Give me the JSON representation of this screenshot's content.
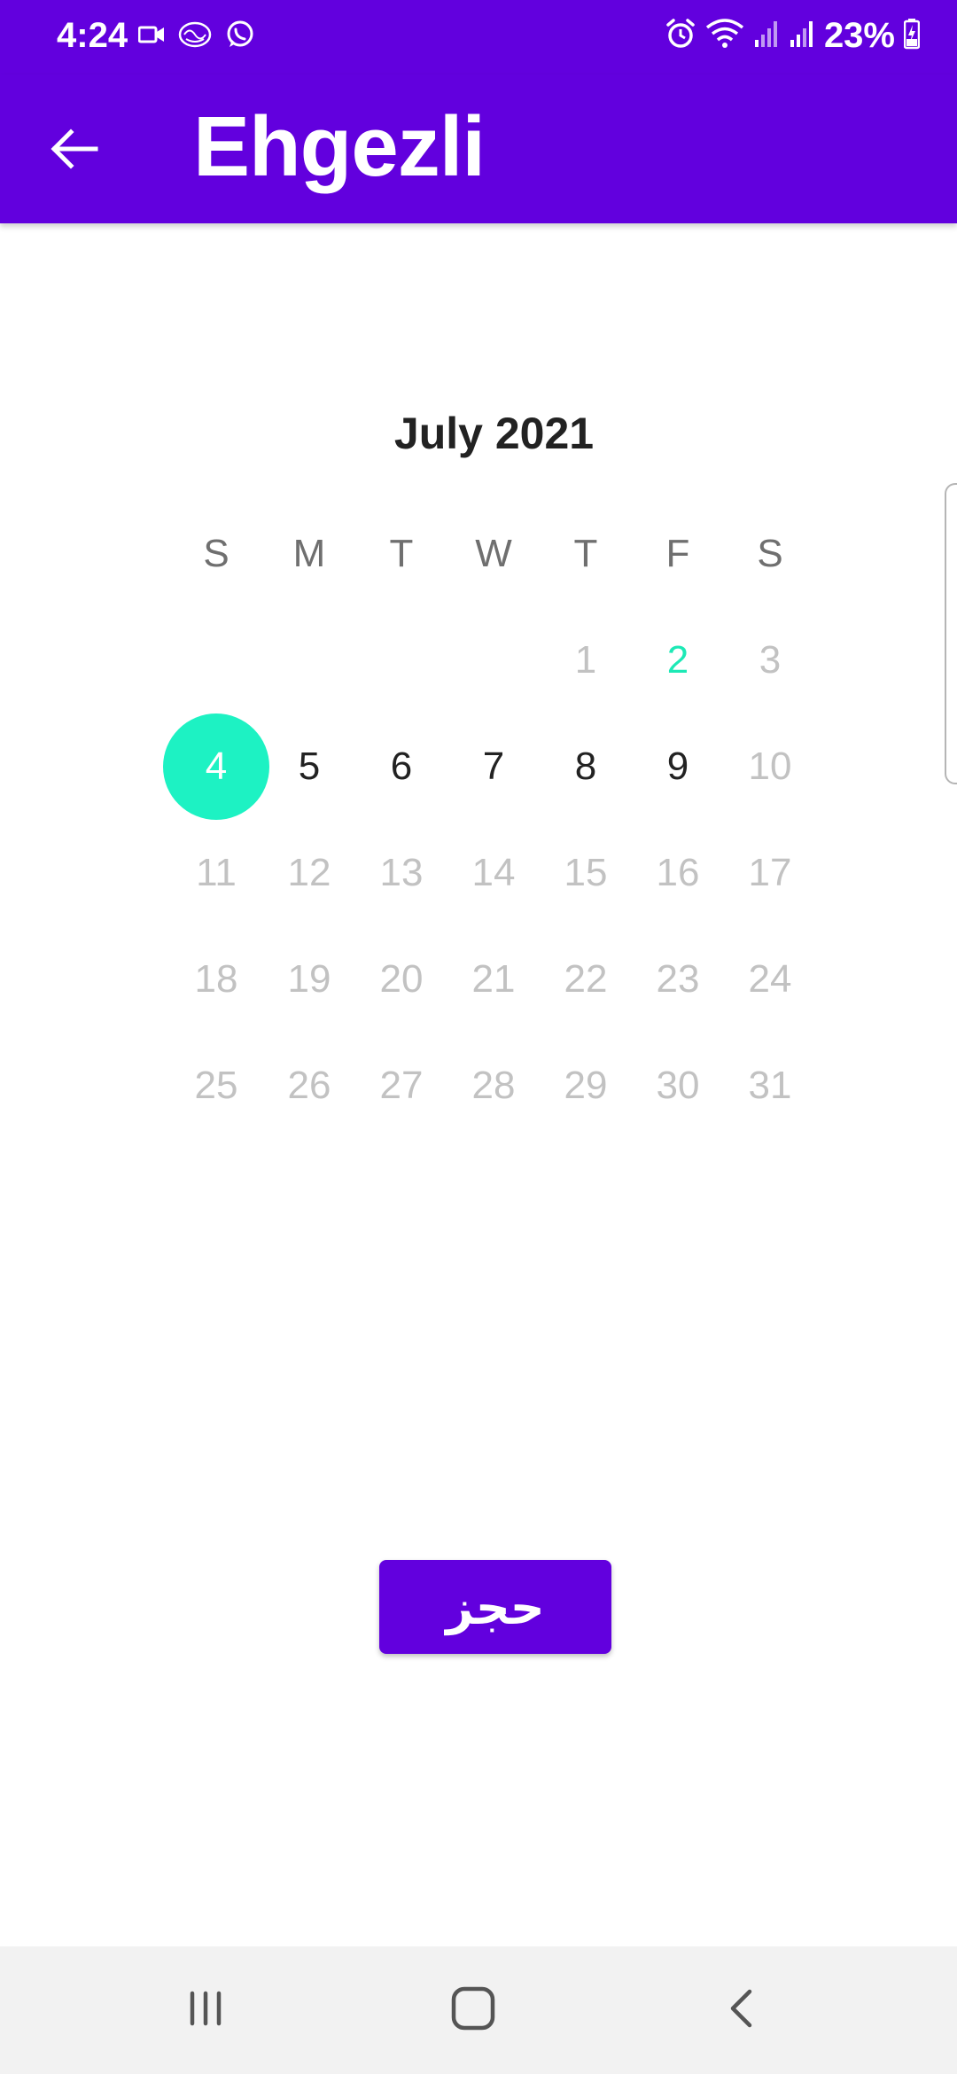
{
  "status_bar": {
    "time": "4:24",
    "battery": "23%",
    "icons_left": [
      "video-icon",
      "app-icon",
      "whatsapp-icon"
    ],
    "icons_right": [
      "alarm-icon",
      "wifi-icon",
      "signal-icon",
      "signal-icon",
      "battery-charging-icon"
    ]
  },
  "app_bar": {
    "title": "Ehgezli",
    "back_icon": "arrow-back-icon"
  },
  "calendar": {
    "month_label": "July 2021",
    "weekdays": [
      "S",
      "M",
      "T",
      "W",
      "T",
      "F",
      "S"
    ],
    "first_weekday_index": 4,
    "days": [
      {
        "label": "1",
        "state": "disabled"
      },
      {
        "label": "2",
        "state": "today"
      },
      {
        "label": "3",
        "state": "disabled"
      },
      {
        "label": "4",
        "state": "selected"
      },
      {
        "label": "5",
        "state": "enabled"
      },
      {
        "label": "6",
        "state": "enabled"
      },
      {
        "label": "7",
        "state": "enabled"
      },
      {
        "label": "8",
        "state": "enabled"
      },
      {
        "label": "9",
        "state": "enabled"
      },
      {
        "label": "10",
        "state": "disabled"
      },
      {
        "label": "11",
        "state": "disabled"
      },
      {
        "label": "12",
        "state": "disabled"
      },
      {
        "label": "13",
        "state": "disabled"
      },
      {
        "label": "14",
        "state": "disabled"
      },
      {
        "label": "15",
        "state": "disabled"
      },
      {
        "label": "16",
        "state": "disabled"
      },
      {
        "label": "17",
        "state": "disabled"
      },
      {
        "label": "18",
        "state": "disabled"
      },
      {
        "label": "19",
        "state": "disabled"
      },
      {
        "label": "20",
        "state": "disabled"
      },
      {
        "label": "21",
        "state": "disabled"
      },
      {
        "label": "22",
        "state": "disabled"
      },
      {
        "label": "23",
        "state": "disabled"
      },
      {
        "label": "24",
        "state": "disabled"
      },
      {
        "label": "25",
        "state": "disabled"
      },
      {
        "label": "26",
        "state": "disabled"
      },
      {
        "label": "27",
        "state": "disabled"
      },
      {
        "label": "28",
        "state": "disabled"
      },
      {
        "label": "29",
        "state": "disabled"
      },
      {
        "label": "30",
        "state": "disabled"
      },
      {
        "label": "31",
        "state": "disabled"
      }
    ]
  },
  "book_button": {
    "label": "حجز"
  },
  "nav_bar": {
    "icons": [
      "recent-apps-icon",
      "home-icon",
      "back-icon"
    ]
  },
  "colors": {
    "primary": "#6200DE",
    "accent": "#1DF2C3",
    "today_text": "#1DE9B6",
    "disabled_text": "#C2C2C2",
    "enabled_text": "#222222"
  }
}
